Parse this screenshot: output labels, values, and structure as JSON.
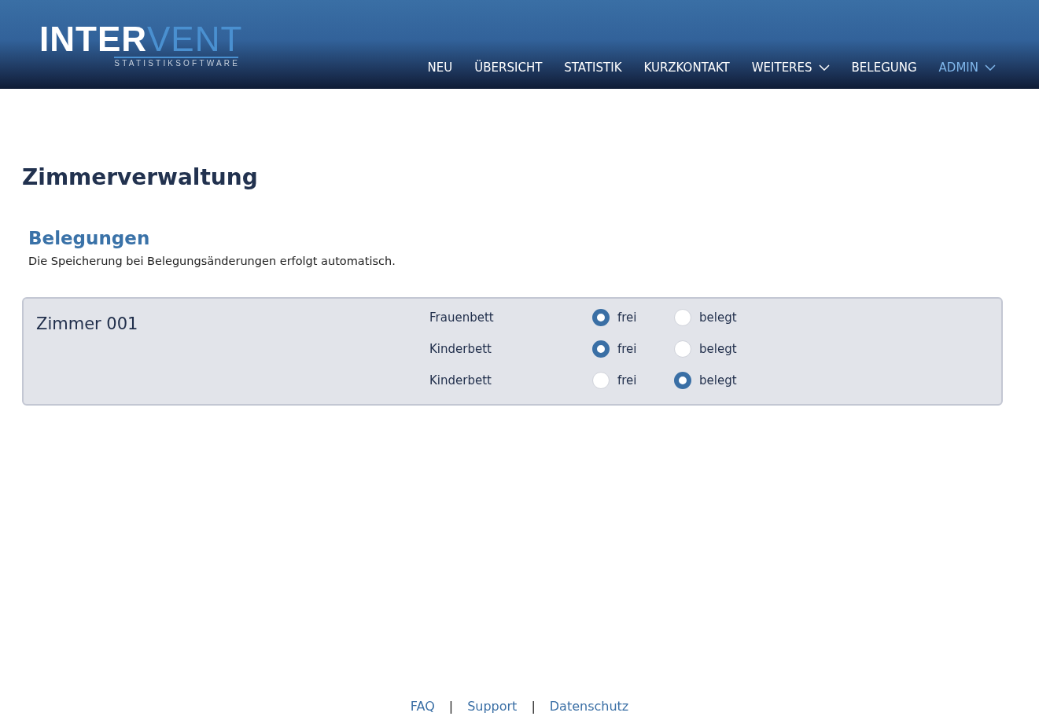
{
  "logo": {
    "part_1": "INTER",
    "part_2": "VENT",
    "tagline": "STATISTIKSOFTWARE"
  },
  "nav": [
    {
      "label": "NEU",
      "selected": false,
      "dropdown": false
    },
    {
      "label": "ÜBERSICHT",
      "selected": false,
      "dropdown": false
    },
    {
      "label": "STATISTIK",
      "selected": false,
      "dropdown": false
    },
    {
      "label": "KURZKONTAKT",
      "selected": false,
      "dropdown": false
    },
    {
      "label": "WEITERES",
      "selected": false,
      "dropdown": true
    },
    {
      "label": "BELEGUNG",
      "selected": false,
      "dropdown": false
    },
    {
      "label": "ADMIN",
      "selected": true,
      "dropdown": true
    }
  ],
  "page_title": "Zimmerverwaltung",
  "section": {
    "title": "Belegungen",
    "note": "Die Speicherung bei Belegungsänderungen erfolgt automatisch."
  },
  "rooms": [
    {
      "name": "Zimmer 001",
      "beds": [
        {
          "name": "Frauenbett",
          "options": [
            {
              "label": "frei",
              "selected": true
            },
            {
              "label": "belegt",
              "selected": false
            }
          ]
        },
        {
          "name": "Kinderbett",
          "options": [
            {
              "label": "frei",
              "selected": true
            },
            {
              "label": "belegt",
              "selected": false
            }
          ]
        },
        {
          "name": "Kinderbett",
          "options": [
            {
              "label": "frei",
              "selected": false
            },
            {
              "label": "belegt",
              "selected": true
            }
          ]
        }
      ]
    }
  ],
  "footer": {
    "links": [
      "FAQ",
      "Support",
      "Datenschutz"
    ],
    "separator": "|"
  }
}
